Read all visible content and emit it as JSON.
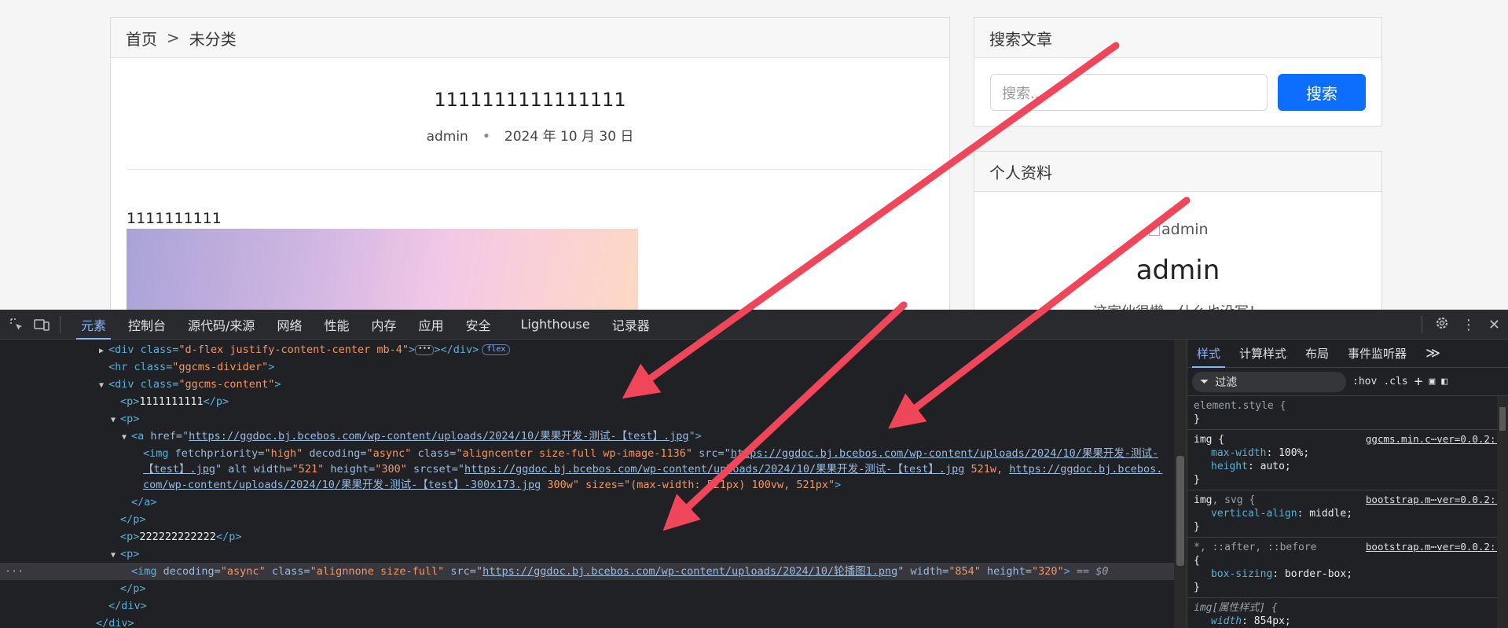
{
  "breadcrumb": {
    "home": "首页",
    "sep": ">",
    "category": "未分类"
  },
  "post": {
    "title": "1111111111111111",
    "author": "admin",
    "meta_dot": "•",
    "date": "2024 年 10 月 30 日",
    "paragraph": "1111111111"
  },
  "sidebar": {
    "search_title": "搜索文章",
    "search_placeholder": "搜索...",
    "search_button": "搜索",
    "profile_title": "个人资料",
    "avatar_alt": "admin",
    "profile_name": "admin",
    "profile_bio": "这家伙很懒，什么也没写！"
  },
  "devtools": {
    "tabs": [
      "元素",
      "控制台",
      "源代码/来源",
      "网络",
      "性能",
      "内存",
      "应用",
      "安全",
      "Lighthouse",
      "记录器"
    ],
    "active_tab": "元素",
    "dom_lines": {
      "l1_tag": "<div class=",
      "l1_val": "\"d-flex justify-content-center mb-4\"",
      "l1_end": "></div>",
      "l1_badge": "flex",
      "l2": "<hr class=",
      "l2_val": "\"ggcms-divider\"",
      "l3": "<div class=",
      "l3_val": "\"ggcms-content\"",
      "l4_text": "1111111111",
      "l6_href": "https://ggdoc.bj.bcebos.com/wp-content/uploads/2024/10/果果开发-测试-【test】.jpg",
      "l7_a": "fetchpriority=",
      "l7_v1": "\"high\"",
      "l7_b": " decoding=",
      "l7_v2": "\"async\"",
      "l7_c": " class=",
      "l7_v3": "\"aligncenter size-full wp-image-1136\"",
      "l7_d": " src=\"",
      "l7_url": "https://ggdoc.bj.bcebos.com/wp-content/uploads/2024/10/果果开发-测试-",
      "l8_url": "【test】.jpg",
      "l8_a": "\" alt width=",
      "l8_v1": "\"521\"",
      "l8_b": " height=",
      "l8_v2": "\"300\"",
      "l8_c": " srcset=\"",
      "l8_url2": "https://ggdoc.bj.bcebos.com/wp-content/uploads/2024/10/果果开发-测试-【test】.jpg",
      "l8_w": " 521w, ",
      "l8_url3": "https://ggdoc.bj.bcebos.",
      "l9_url": "com/wp-content/uploads/2024/10/果果开发-测试-【test】-300x173.jpg",
      "l9_w": " 300w\" sizes=",
      "l9_v": "\"(max-width: 521px) 100vw, 521px\"",
      "l12_text": "222222222222",
      "l14_a": "decoding=",
      "l14_v1": "\"async\"",
      "l14_b": " class=",
      "l14_v2": "\"alignnone size-full\"",
      "l14_c": " src=\"",
      "l14_url": "https://ggdoc.bj.bcebos.com/wp-content/uploads/2024/10/轮播图1.png",
      "l14_d": "\" width=",
      "l14_v3": "\"854\"",
      "l14_e": " height=",
      "l14_v4": "\"320\"",
      "l14_eq": "== $0"
    },
    "styles": {
      "tabs": [
        "样式",
        "计算样式",
        "布局",
        "事件监听器"
      ],
      "filter": "过滤",
      "hov": ":hov",
      "cls": ".cls",
      "rule1": "element.style {",
      "rule2_sel": "img {",
      "rule2_src": "ggcms.min.c⋯ver=0.0.2:1",
      "rule2_p1": "max-width",
      "rule2_v1": "100%;",
      "rule2_p2": "height",
      "rule2_v2": "auto;",
      "rule3_sel_a": "img",
      "rule3_sel_b": ", svg {",
      "rule3_src": "bootstrap.m⋯ver=0.0.2:1",
      "rule3_p": "vertical-align",
      "rule3_v": "middle;",
      "rule4_sel": "*, ::after, ::before",
      "rule4_src": "bootstrap.m⋯ver=0.0.2:1",
      "rule4_p": "box-sizing",
      "rule4_v": "border-box;",
      "rule5_sel": "img[属性样式] {",
      "rule5_p": "width",
      "rule5_v": "854px;"
    }
  },
  "colors": {
    "accent": "#0d6efd",
    "arrow": "#f0465a",
    "devtools_bg": "#202124"
  }
}
